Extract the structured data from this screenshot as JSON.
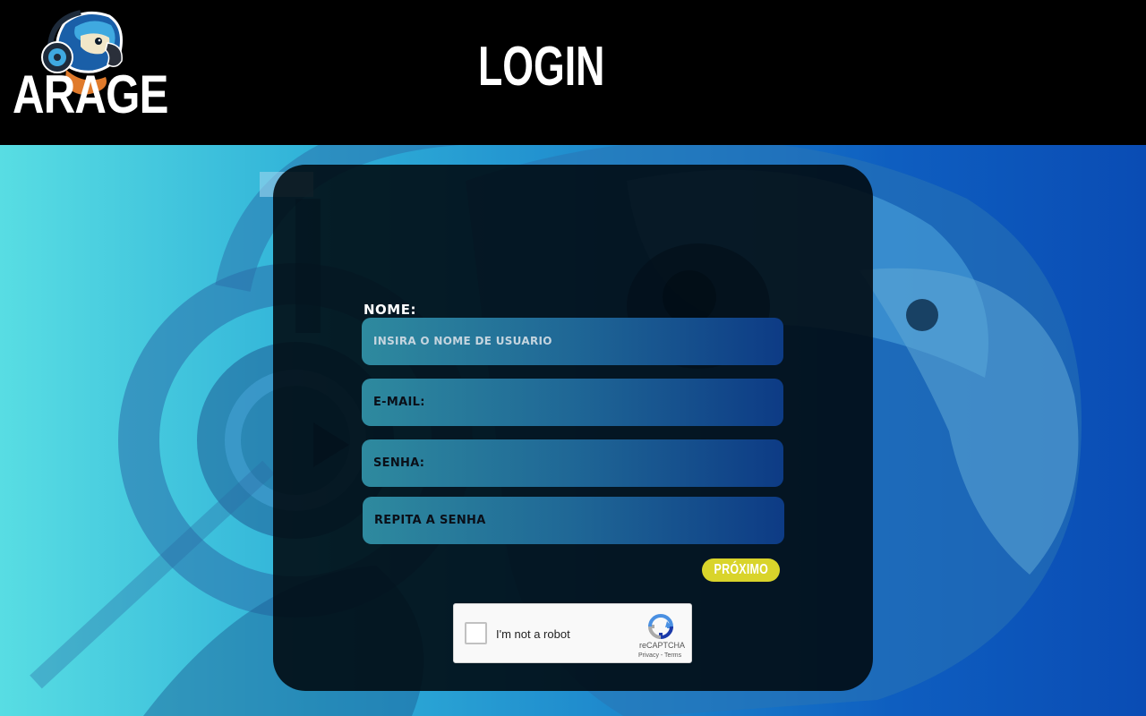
{
  "header": {
    "logo_text": "ARAGE",
    "page_title": "LOGIN"
  },
  "form": {
    "name_label": "NOME:",
    "name_placeholder": "INSIRA O NOME DE USUARIO",
    "email_placeholder": "E-MAIL:",
    "password_placeholder": "SENHA:",
    "repeat_password_placeholder": "REPITA A SENHA",
    "next_button": "PRÓXIMO"
  },
  "captcha": {
    "label": "I'm not a robot",
    "brand": "reCAPTCHA",
    "links": "Privacy - Terms"
  },
  "colors": {
    "header_bg": "#000000",
    "card_bg": "#00080e",
    "button_bg": "#d9d42b",
    "input_gradient_start": "#2e8a9f",
    "input_gradient_end": "#0d3b85"
  }
}
